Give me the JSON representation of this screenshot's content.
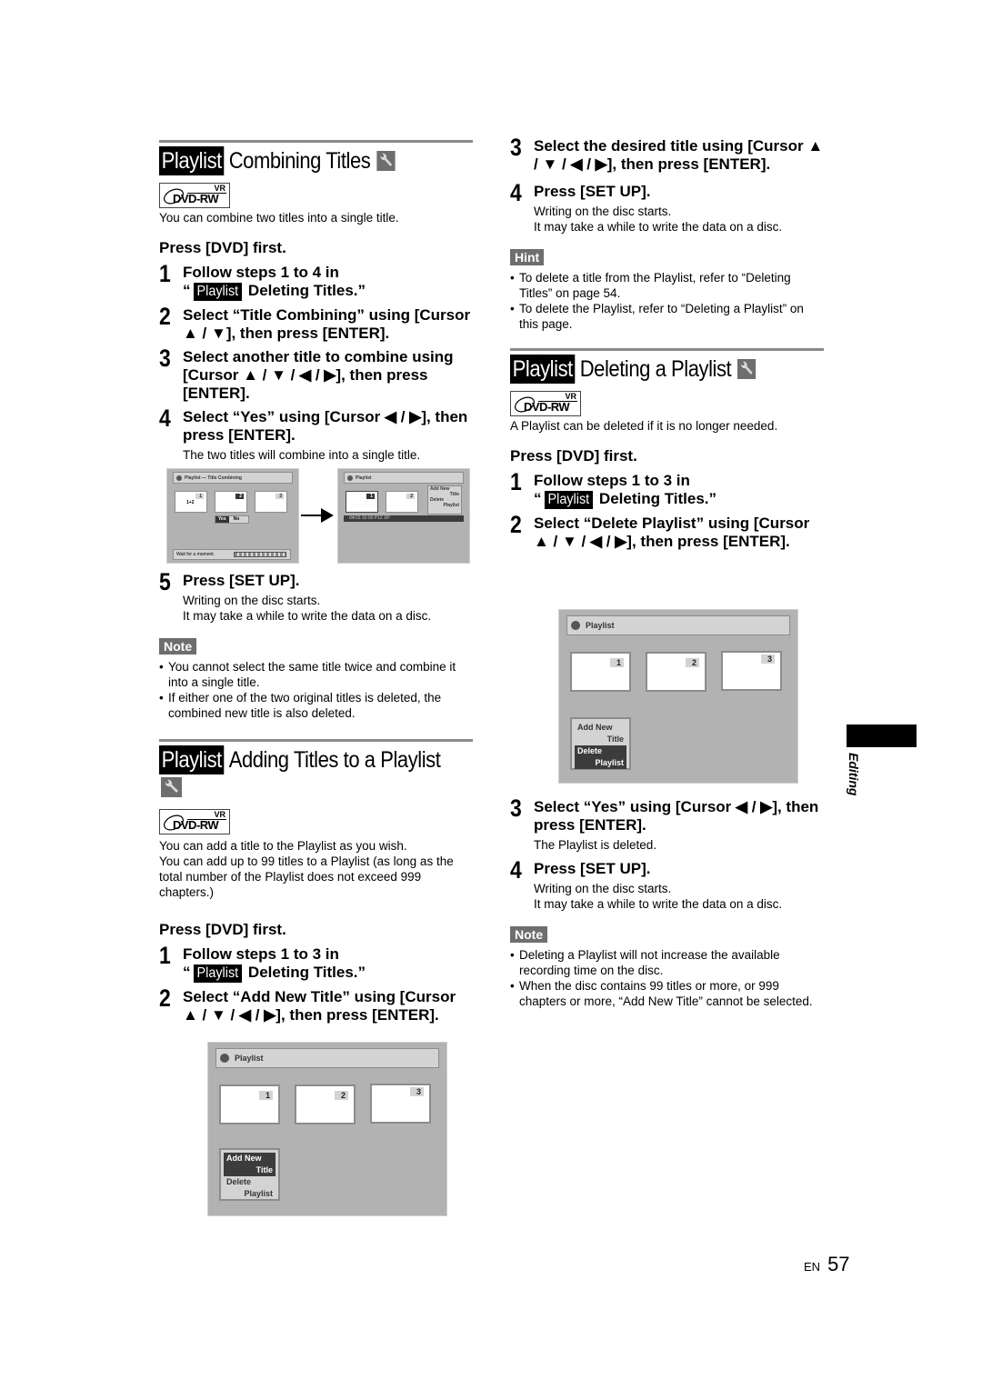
{
  "playlist_badge": "Playlist",
  "combining": {
    "title": "Combining Titles",
    "disc_logo": {
      "vr": "VR",
      "format": "DVD-RW"
    },
    "intro": "You can combine two titles into a single title.",
    "press_first": "Press [DVD] first.",
    "steps": [
      {
        "num": "1",
        "text_pre": "Follow steps 1 to 4 in",
        "text_quote_open": "“",
        "text_link": "Deleting Titles.”"
      },
      {
        "num": "2",
        "text": "Select “Title Combining” using [Cursor ▲ / ▼], then press [ENTER]."
      },
      {
        "num": "3",
        "text": "Select another title to combine using [Cursor ▲ / ▼ / ◀ / ▶], then press [ENTER]."
      },
      {
        "num": "4",
        "text": "Select “Yes” using [Cursor ◀ / ▶], then press [ENTER].",
        "sub": "The two titles will combine into a single title."
      },
      {
        "num": "5",
        "text": "Press [SET UP].",
        "sub1": "Writing on the disc starts.",
        "sub2": "It may take a while to write the data on a disc."
      }
    ],
    "screen_before": {
      "title": "Playlist — Title Combining",
      "thumbs": [
        {
          "num": "1",
          "label": "1+2"
        },
        {
          "num": "2"
        },
        {
          "num": "3"
        }
      ],
      "yes": "Yes",
      "no": "No",
      "status": "Wait for a moment."
    },
    "screen_after": {
      "title": "Playlist",
      "thumbs": [
        {
          "num": "1"
        },
        {
          "num": "2"
        }
      ],
      "menu": [
        "Add New",
        "Title",
        "Delete",
        "Playlist"
      ],
      "info_bar": "04/15  10:00  P12  XP"
    },
    "note_label": "Note",
    "notes": [
      "You cannot select the same title twice and combine it into a single title.",
      "If either one of the two original titles is deleted, the combined new title is also deleted."
    ]
  },
  "adding": {
    "title": "Adding Titles to a Playlist",
    "disc_logo": {
      "vr": "VR",
      "format": "DVD-RW"
    },
    "intro1": "You can add a title to the Playlist as you wish.",
    "intro2": "You can add up to 99 titles to a Playlist (as long as the total number of the Playlist does not exceed 999 chapters.)",
    "press_first": "Press [DVD] first.",
    "steps": [
      {
        "num": "1",
        "text_pre": "Follow steps 1 to 3 in",
        "text_quote_open": "“",
        "text_link": "Deleting Titles.”"
      },
      {
        "num": "2",
        "text": "Select “Add New Title” using [Cursor ▲ / ▼ / ◀ / ▶], then press [ENTER]."
      },
      {
        "num": "3",
        "text": "Select the desired title using [Cursor ▲ / ▼ / ◀ / ▶], then press [ENTER]."
      },
      {
        "num": "4",
        "text": "Press [SET UP].",
        "sub1": "Writing on the disc starts.",
        "sub2": "It may take a while to write the data on a disc."
      }
    ],
    "screen": {
      "title": "Playlist",
      "thumbs": [
        {
          "num": "1"
        },
        {
          "num": "2"
        },
        {
          "num": "3"
        }
      ],
      "menu": [
        "Add New",
        "Title",
        "Delete",
        "Playlist"
      ],
      "selected": "Add New Title"
    },
    "hint_label": "Hint",
    "hints": [
      "To delete a title from the Playlist, refer to “Deleting Titles” on page 54.",
      "To delete the Playlist, refer to “Deleting a Playlist” on this page."
    ]
  },
  "deleting": {
    "title": "Deleting a Playlist",
    "disc_logo": {
      "vr": "VR",
      "format": "DVD-RW"
    },
    "intro": "A Playlist can be deleted if it is no longer needed.",
    "press_first": "Press [DVD] first.",
    "steps": [
      {
        "num": "1",
        "text_pre": "Follow steps 1 to 3 in",
        "text_quote_open": "“",
        "text_link": "Deleting Titles.”"
      },
      {
        "num": "2",
        "text": "Select “Delete Playlist” using [Cursor ▲ / ▼ / ◀ / ▶], then press [ENTER]."
      },
      {
        "num": "3",
        "text": "Select “Yes” using [Cursor ◀ / ▶], then press [ENTER].",
        "sub": "The Playlist is deleted."
      },
      {
        "num": "4",
        "text": "Press [SET UP].",
        "sub1": "Writing on the disc starts.",
        "sub2": "It may take a while to write the data on a disc."
      }
    ],
    "screen": {
      "title": "Playlist",
      "thumbs": [
        {
          "num": "1"
        },
        {
          "num": "2"
        },
        {
          "num": "3"
        }
      ],
      "menu": [
        "Add New",
        "Title",
        "Delete",
        "Playlist"
      ],
      "selected": "Delete Playlist"
    },
    "note_label": "Note",
    "notes": [
      "Deleting a Playlist will not increase the available recording time on the disc.",
      "When the disc contains 99 titles or more, or 999 chapters or more, “Add New Title” cannot be selected."
    ]
  },
  "side_tab": "Editing",
  "footer": {
    "lang": "EN",
    "page": "57"
  }
}
